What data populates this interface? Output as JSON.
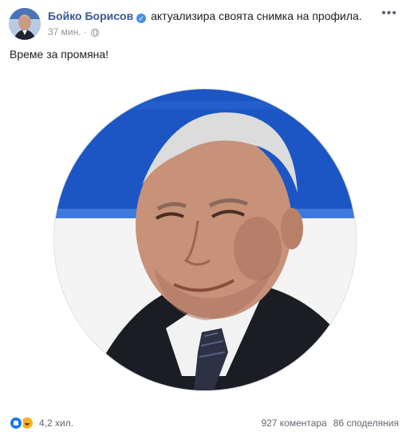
{
  "header": {
    "author_name": "Бойко Борисов",
    "action_text": "актуализира своята снимка на профила.",
    "timestamp": "37 мин.",
    "privacy_icon": "globe-icon",
    "more_icon": "ellipsis-icon",
    "verified_icon": "verified-badge-icon"
  },
  "post": {
    "text": "Време за промяна!"
  },
  "footer": {
    "reaction_icons": [
      "like-icon",
      "haha-icon"
    ],
    "reaction_count": "4,2 хил.",
    "comments": "927 коментара",
    "shares": "86 споделяния"
  },
  "colors": {
    "author_link": "#385898",
    "meta_text": "#90949c",
    "like_blue": "#1877f2",
    "haha_yellow": "#f7b125"
  }
}
